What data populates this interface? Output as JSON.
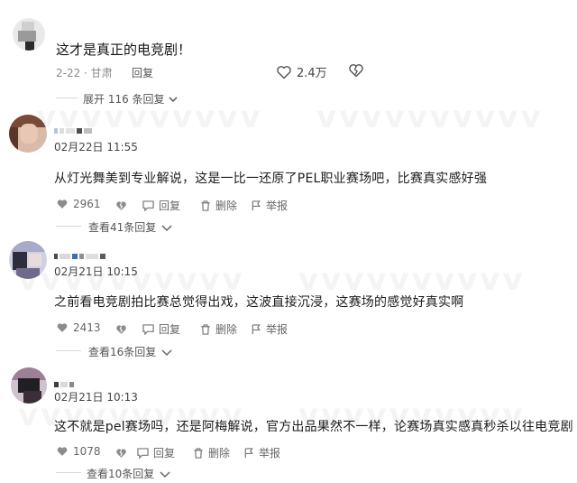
{
  "top_comment": {
    "text": "这才是真正的电竞剧！",
    "meta": "2-22 · 甘肃",
    "reply_label": "回复",
    "likes": "2.4万",
    "expand_label": "展开 116 条回复"
  },
  "comments": [
    {
      "date": "02月22日 11:55",
      "text": "从灯光舞美到专业解说，这是一比一还原了PEL职业赛场吧，比赛真实感好强",
      "likes": "2961",
      "reply_label": "回复",
      "delete_label": "删除",
      "report_label": "举报",
      "view_replies": "查看41条回复"
    },
    {
      "date": "02月21日 10:15",
      "text": "之前看电竞剧拍比赛总觉得出戏，这波直接沉浸，这赛场的感觉好真实啊",
      "likes": "2413",
      "reply_label": "回复",
      "delete_label": "删除",
      "report_label": "举报",
      "view_replies": "查看16条回复"
    },
    {
      "date": "02月21日 10:13",
      "text": "这不就是pel赛场吗，还是阿梅解说，官方出品果然不一样，论赛场真实感真秒杀以往电竞剧",
      "likes": "1078",
      "reply_label": "回复",
      "delete_label": "删除",
      "report_label": "举报",
      "view_replies": "查看10条回复"
    }
  ],
  "colors": {
    "text": "#1c1c1c",
    "muted": "#8a8a8a",
    "icon": "#888888"
  },
  "icons": [
    "heart-icon",
    "broken-heart-icon",
    "thumbs-down-icon",
    "comment-icon",
    "trash-icon",
    "flag-icon",
    "chevron-down-icon"
  ]
}
